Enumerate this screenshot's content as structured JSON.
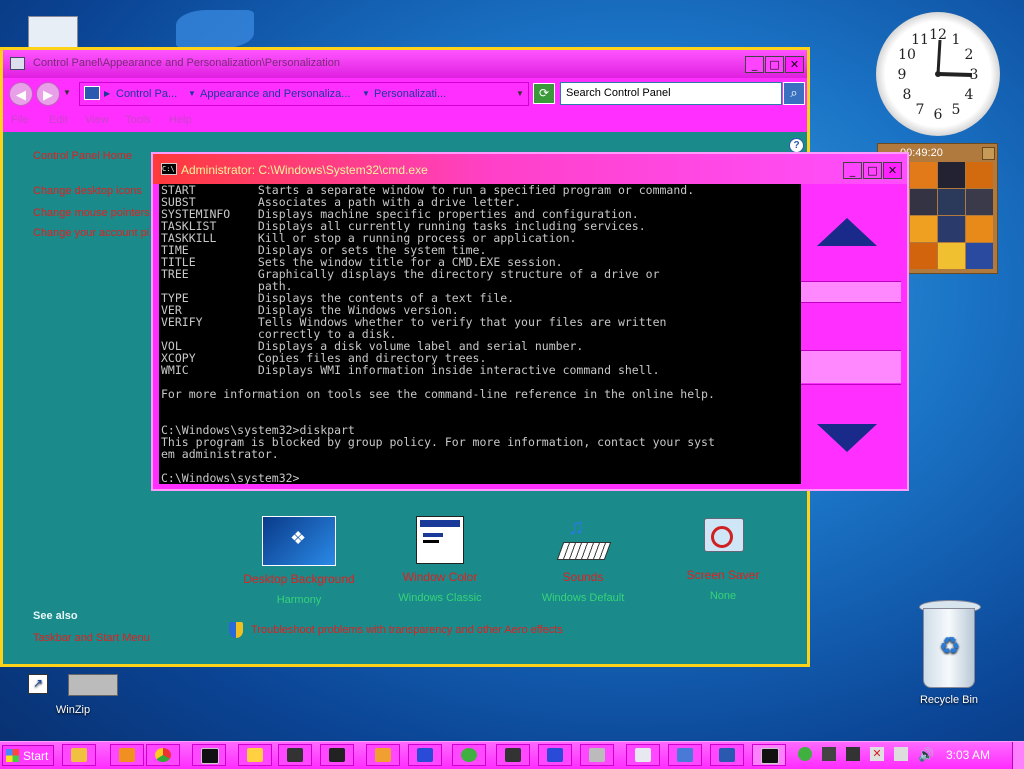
{
  "desktop": {
    "icons": [
      {
        "label": "WinZip"
      },
      {
        "label": "Recycle Bin"
      }
    ]
  },
  "control_panel": {
    "title": "Control Panel\\Appearance and Personalization\\Personalization",
    "breadcrumbs": [
      "Control Pa...",
      "Appearance and Personaliza...",
      "Personalizati..."
    ],
    "search_placeholder": "Search Control Panel",
    "menu": [
      "File",
      "Edit",
      "View",
      "Tools",
      "Help"
    ],
    "sidebar": {
      "home": "Control Panel Home",
      "links": [
        "Change desktop icons",
        "Change mouse pointers",
        "Change your account pi"
      ],
      "see_also_heading": "See also",
      "see_also_links": [
        "Taskbar and Start Menu"
      ]
    },
    "personalize_items": [
      {
        "name": "Desktop Background",
        "sub": "Harmony",
        "icon": "desktop-background-icon"
      },
      {
        "name": "Window Color",
        "sub": "Windows Classic",
        "icon": "window-color-icon"
      },
      {
        "name": "Sounds",
        "sub": "Windows Default",
        "icon": "sounds-icon"
      },
      {
        "name": "Screen Saver",
        "sub": "None",
        "icon": "screen-saver-icon"
      }
    ],
    "troubleshoot_link": "Troubleshoot problems with transparency and other Aero effects"
  },
  "cmd": {
    "title": "Administrator: C:\\Windows\\System32\\cmd.exe",
    "icon_text": "C:\\",
    "lines": [
      "START         Starts a separate window to run a specified program or command.",
      "SUBST         Associates a path with a drive letter.",
      "SYSTEMINFO    Displays machine specific properties and configuration.",
      "TASKLIST      Displays all currently running tasks including services.",
      "TASKKILL      Kill or stop a running process or application.",
      "TIME          Displays or sets the system time.",
      "TITLE         Sets the window title for a CMD.EXE session.",
      "TREE          Graphically displays the directory structure of a drive or",
      "              path.",
      "TYPE          Displays the contents of a text file.",
      "VER           Displays the Windows version.",
      "VERIFY        Tells Windows whether to verify that your files are written",
      "              correctly to a disk.",
      "VOL           Displays a disk volume label and serial number.",
      "XCOPY         Copies files and directory trees.",
      "WMIC          Displays WMI information inside interactive command shell.",
      "",
      "For more information on tools see the command-line reference in the online help.",
      "",
      "",
      "C:\\Windows\\system32>diskpart",
      "This program is blocked by group policy. For more information, contact your syst",
      "em administrator.",
      "",
      "C:\\Windows\\system32>"
    ]
  },
  "gadgets": {
    "puzzle_time": "00:49:20"
  },
  "taskbar": {
    "start_label": "Start",
    "clock": "3:03 AM"
  }
}
